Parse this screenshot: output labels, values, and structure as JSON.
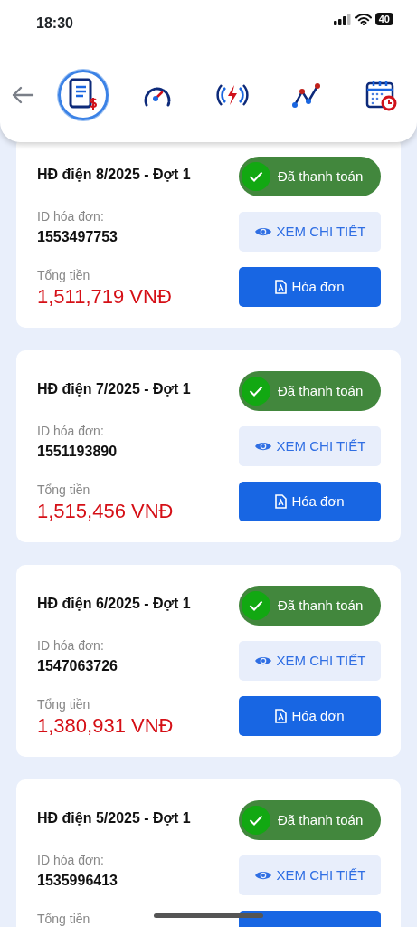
{
  "status_bar": {
    "time": "18:30",
    "battery": "40"
  },
  "nav_tabs": [
    {
      "kind": "invoice",
      "selected": true
    },
    {
      "kind": "gauge",
      "selected": false
    },
    {
      "kind": "power",
      "selected": false
    },
    {
      "kind": "chart",
      "selected": false
    },
    {
      "kind": "calendar",
      "selected": false
    }
  ],
  "bills": [
    {
      "title": "HĐ điện 8/2025 - Đợt 1",
      "status": "Đã thanh toán",
      "paid": true,
      "id_label": "ID hóa đơn:",
      "id": "1553497753",
      "total_label": "Tổng tiền",
      "amount": "1,511,719 VNĐ",
      "detail_label": "XEM CHI TIẾT",
      "invoice_label": "Hóa đơn"
    },
    {
      "title": "HĐ điện 7/2025 - Đợt 1",
      "status": "Đã thanh toán",
      "paid": true,
      "id_label": "ID hóa đơn:",
      "id": "1551193890",
      "total_label": "Tổng tiền",
      "amount": "1,515,456 VNĐ",
      "detail_label": "XEM CHI TIẾT",
      "invoice_label": "Hóa đơn"
    },
    {
      "title": "HĐ điện 6/2025 - Đợt 1",
      "status": "Đã thanh toán",
      "paid": true,
      "id_label": "ID hóa đơn:",
      "id": "1547063726",
      "total_label": "Tổng tiền",
      "amount": "1,380,931 VNĐ",
      "detail_label": "XEM CHI TIẾT",
      "invoice_label": "Hóa đơn"
    },
    {
      "title": "HĐ điện 5/2025 - Đợt 1",
      "status": "Đã thanh toán",
      "paid": true,
      "id_label": "ID hóa đơn:",
      "id": "1535996413",
      "total_label": "Tổng tiền",
      "detail_label": "XEM CHI TIẾT"
    }
  ]
}
